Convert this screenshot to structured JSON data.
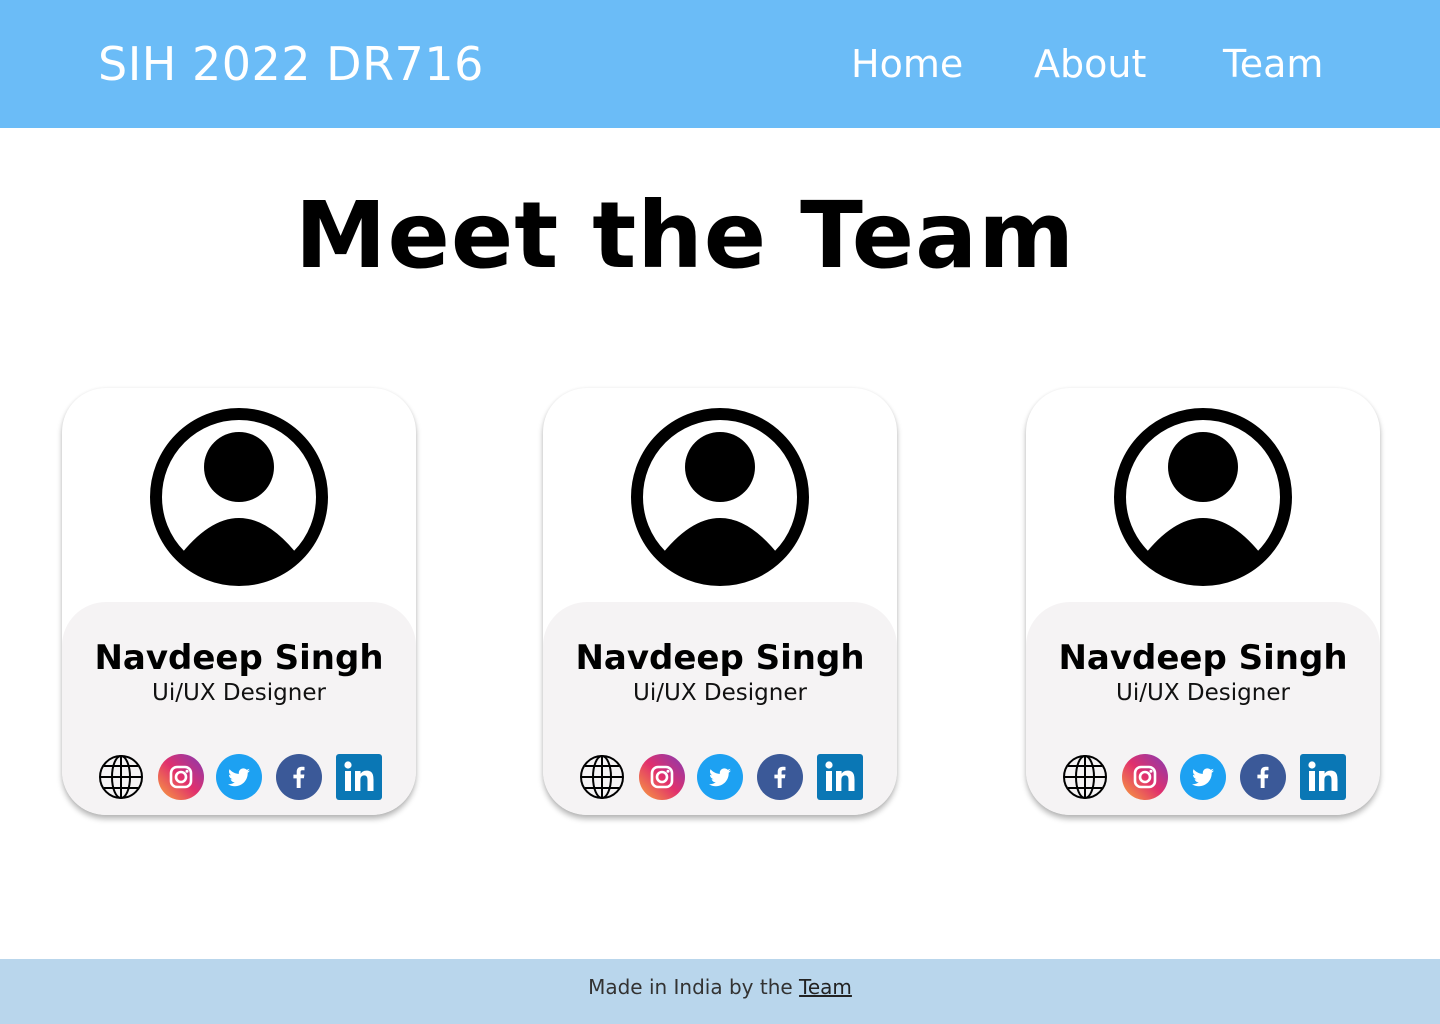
{
  "header": {
    "brand": "SIH 2022 DR716",
    "nav": {
      "home": "Home",
      "about": "About",
      "team": "Team"
    }
  },
  "main": {
    "title": "Meet the Team",
    "members": [
      {
        "name": "Navdeep Singh",
        "role": "Ui/UX Designer",
        "avatar_icon": "user-avatar-icon",
        "socials": [
          "website",
          "instagram",
          "twitter",
          "facebook",
          "linkedin"
        ]
      },
      {
        "name": "Navdeep Singh",
        "role": "Ui/UX Designer",
        "avatar_icon": "user-avatar-icon",
        "socials": [
          "website",
          "instagram",
          "twitter",
          "facebook",
          "linkedin"
        ]
      },
      {
        "name": "Navdeep Singh",
        "role": "Ui/UX Designer",
        "avatar_icon": "user-avatar-icon",
        "socials": [
          "website",
          "instagram",
          "twitter",
          "facebook",
          "linkedin"
        ]
      }
    ]
  },
  "footer": {
    "text": "Made in India by the",
    "link": "Team"
  },
  "colors": {
    "header_bg": "#6bbcf7",
    "footer_bg": "#b9d6ec",
    "card_info_bg": "#f5f3f4",
    "twitter": "#1da1f2",
    "facebook": "#3b5998",
    "linkedin": "#0a77b5",
    "instagram_gradient": [
      "#f9a43c",
      "#e1306c",
      "#833ab4"
    ]
  }
}
